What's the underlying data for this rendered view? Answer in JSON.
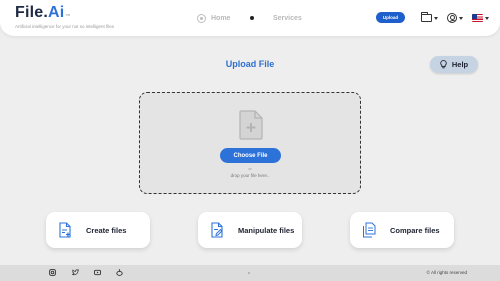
{
  "header": {
    "logo_part1": "File.",
    "logo_part2": "Ai",
    "logo_tm": "TM",
    "tagline": "Artificial intelligence for your not so intelligent files",
    "nav_home": "Home",
    "nav_services": "Services",
    "upload_label": "Upload"
  },
  "main": {
    "title": "Upload File",
    "help_label": "Help",
    "choose_file_label": "Choose File",
    "or_label": "or",
    "drop_text": "drop your file here.."
  },
  "cards": {
    "create": "Create files",
    "manipulate": "Manipulate files",
    "compare": "Compare files"
  },
  "footer": {
    "copyright": "© All rights reserved"
  },
  "colors": {
    "accent": "#2d72d9",
    "upload_button": "#1f5fcb",
    "help_button": "#c6d3e3",
    "background": "#eeeeee"
  }
}
